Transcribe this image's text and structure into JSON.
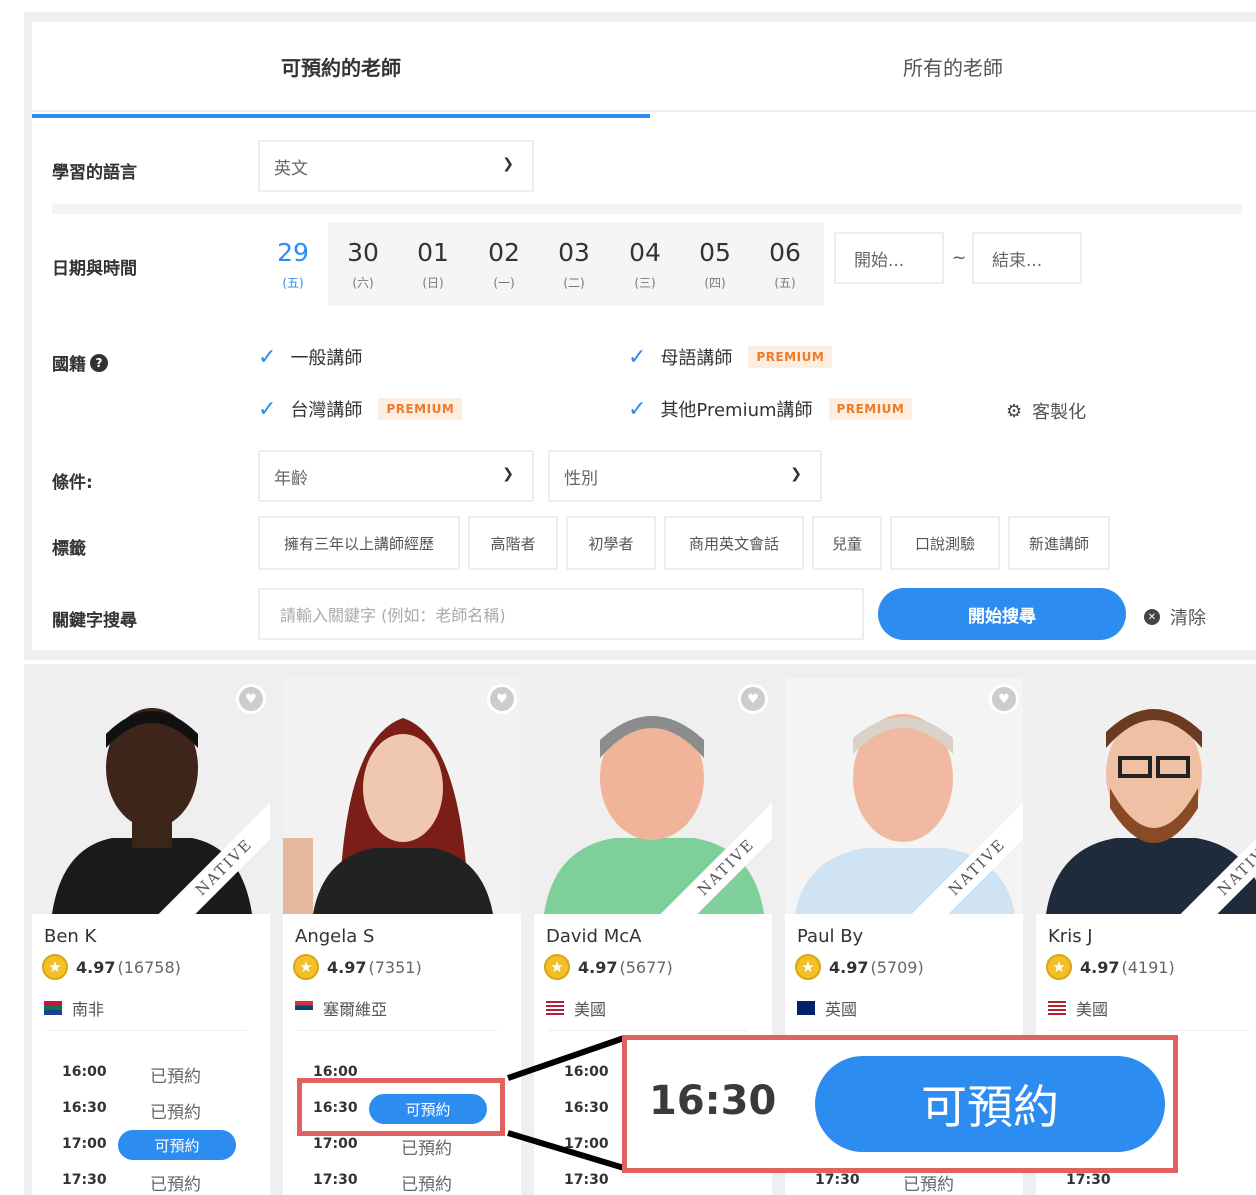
{
  "tabs": [
    "可預約的老師",
    "所有的老師"
  ],
  "filters": {
    "language_label": "學習的語言",
    "language_value": "英文",
    "datetime_label": "日期與時間",
    "dates": [
      {
        "num": "29",
        "dow": "(五)"
      },
      {
        "num": "30",
        "dow": "(六)"
      },
      {
        "num": "01",
        "dow": "(日)"
      },
      {
        "num": "02",
        "dow": "(一)"
      },
      {
        "num": "03",
        "dow": "(二)"
      },
      {
        "num": "04",
        "dow": "(三)"
      },
      {
        "num": "05",
        "dow": "(四)"
      },
      {
        "num": "06",
        "dow": "(五)"
      }
    ],
    "start_placeholder": "開始...",
    "tilde": "~",
    "end_placeholder": "結束...",
    "nationality_label": "國籍",
    "nationality_options": [
      "一般講師",
      "母語講師",
      "台灣講師",
      "其他Premium講師"
    ],
    "premium_badge": "PREMIUM",
    "customize": "客製化",
    "condition_label": "條件:",
    "age_select": "年齡",
    "gender_select": "性別",
    "tags_label": "標籤",
    "tags": [
      "擁有三年以上講師經歷",
      "高階者",
      "初學者",
      "商用英文會話",
      "兒童",
      "口說測驗",
      "新進講師"
    ],
    "keyword_label": "關鍵字搜尋",
    "keyword_placeholder": "請輸入關鍵字 (例如：老師名稱)",
    "search_button": "開始搜尋",
    "clear": "清除"
  },
  "native_label": "NATIVE",
  "teachers": [
    {
      "name": "Ben K",
      "score": "4.97",
      "count": "(16758)",
      "country": "南非"
    },
    {
      "name": "Angela S",
      "score": "4.97",
      "count": "(7351)",
      "country": "塞爾維亞"
    },
    {
      "name": "David McA",
      "score": "4.97",
      "count": "(5677)",
      "country": "美國"
    },
    {
      "name": "Paul By",
      "score": "4.97",
      "count": "(5709)",
      "country": "英國"
    },
    {
      "name": "Kris J",
      "score": "4.97",
      "count": "(4191)",
      "country": "美國"
    }
  ],
  "slots": {
    "t1": [
      "16:00",
      "16:30",
      "17:00",
      "17:30"
    ],
    "booked": "已預約",
    "available": "可預約",
    "t_last": "17:30"
  },
  "highlight": {
    "time": "16:30",
    "button": "可預約"
  },
  "colors": {
    "accent": "#2d8cf0",
    "highlight_border": "#e0625f",
    "premium_text": "#f07a2a"
  }
}
